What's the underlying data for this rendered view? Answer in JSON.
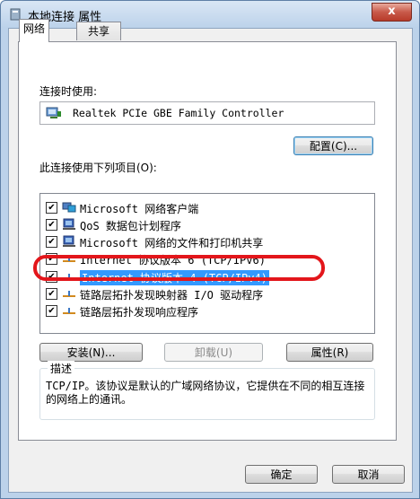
{
  "window": {
    "title": "本地连接 属性",
    "close_label": "x"
  },
  "tabs": [
    {
      "label": "网络"
    },
    {
      "label": "共享"
    }
  ],
  "connect_using": {
    "label": "连接时使用:",
    "adapter": "Realtek PCIe GBE Family Controller",
    "configure_label": "配置(C)..."
  },
  "items_section": {
    "label": "此连接使用下列项目(O):",
    "items": [
      {
        "label": "Microsoft 网络客户端",
        "checked": true,
        "icon": "network-client-icon"
      },
      {
        "label": "QoS 数据包计划程序",
        "checked": true,
        "icon": "qos-scheduler-icon"
      },
      {
        "label": "Microsoft 网络的文件和打印机共享",
        "checked": true,
        "icon": "file-printer-sharing-icon"
      },
      {
        "label": "Internet 协议版本 6 (TCP/IPv6)",
        "checked": true,
        "icon": "protocol-icon"
      },
      {
        "label": "Internet 协议版本 4 (TCP/IPv4)",
        "checked": true,
        "icon": "protocol-icon",
        "selected": true
      },
      {
        "label": "链路层拓扑发现映射器 I/O 驱动程序",
        "checked": true,
        "icon": "protocol-icon"
      },
      {
        "label": "链路层拓扑发现响应程序",
        "checked": true,
        "icon": "protocol-icon"
      }
    ]
  },
  "actions": {
    "install_label": "安装(N)...",
    "uninstall_label": "卸载(U)",
    "properties_label": "属性(R)"
  },
  "description": {
    "title": "描述",
    "text": "TCP/IP。该协议是默认的广域网络协议，它提供在不同的相互连接的网络上的通讯。"
  },
  "footer": {
    "ok_label": "确定",
    "cancel_label": "取消"
  },
  "colors": {
    "highlight": "#3399ff",
    "annotation_red": "#e3161b"
  }
}
